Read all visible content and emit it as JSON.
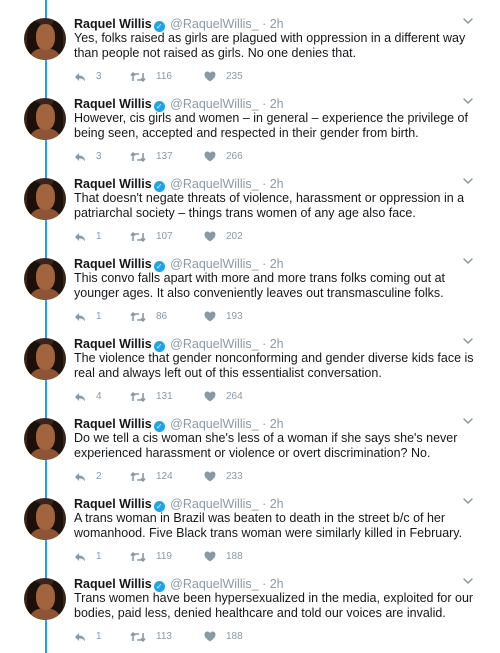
{
  "author": {
    "name": "Raquel Willis",
    "handle": "@RaquelWillis_",
    "separator": "·",
    "time": "2h"
  },
  "tweets": [
    {
      "text": "Yes, folks raised as girls are plagued with oppression in a different way than people not raised as girls. No one denies that.",
      "replies": "3",
      "retweets": "116",
      "likes": "235"
    },
    {
      "text": "However, cis girls and women – in general – experience the privilege of being seen, accepted and respected in their gender from birth.",
      "replies": "3",
      "retweets": "137",
      "likes": "266"
    },
    {
      "text": "That doesn't negate threats of violence, harassment or oppression in a patriarchal society – things trans women of any age also face.",
      "replies": "1",
      "retweets": "107",
      "likes": "202"
    },
    {
      "text": "This convo falls apart with more and more trans folks coming out at younger ages. It also conveniently leaves out transmasculine folks.",
      "replies": "1",
      "retweets": "86",
      "likes": "193"
    },
    {
      "text": "The violence that gender nonconforming and gender diverse kids face is real and always left out of this essentialist conversation.",
      "replies": "4",
      "retweets": "131",
      "likes": "264"
    },
    {
      "text": "Do we tell a cis woman she's less of a woman if she says she's never experienced harassment or violence or overt discrimination? No.",
      "replies": "2",
      "retweets": "124",
      "likes": "233"
    },
    {
      "text": "A trans woman in Brazil was beaten to death in the street b/c of her womanhood. Five Black trans woman were similarly killed in February.",
      "replies": "1",
      "retweets": "119",
      "likes": "188"
    },
    {
      "text": "Trans women have been hypersexualized in the media, exploited for our bodies, paid less, denied healthcare and told our voices are invalid.",
      "replies": "1",
      "retweets": "113",
      "likes": "188"
    }
  ],
  "colors": {
    "thread_line": "#1da1f2",
    "verified": "#1da1f2",
    "meta": "#8899a6"
  },
  "icons": [
    "reply-icon",
    "retweet-icon",
    "like-icon",
    "chevron-down-icon",
    "verified-icon"
  ]
}
